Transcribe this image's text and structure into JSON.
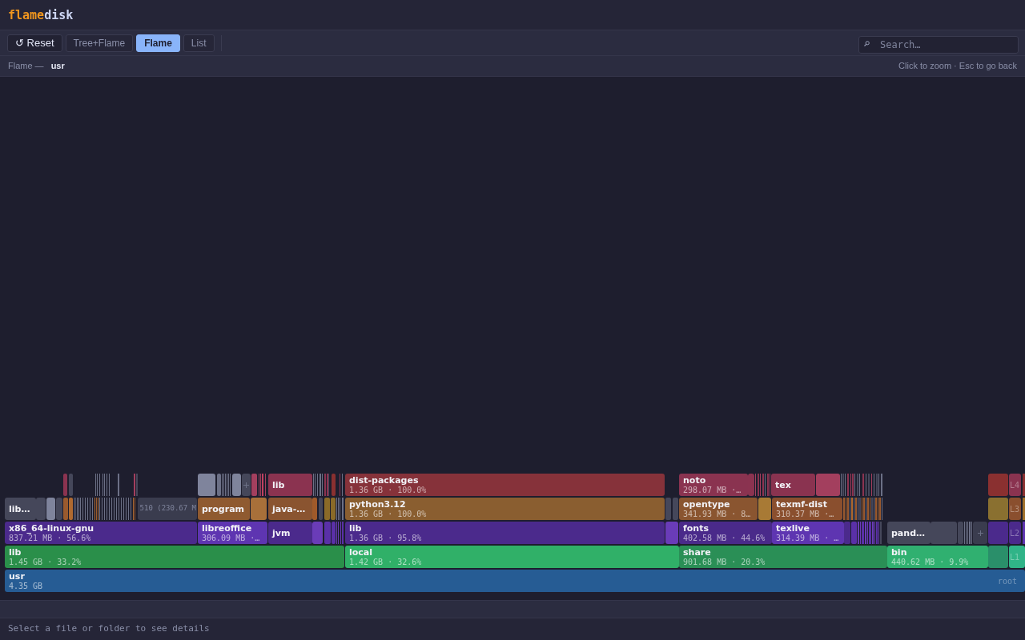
{
  "logo": {
    "accent": "flame",
    "rest": "disk"
  },
  "toolbar": {
    "reset_button": "↺ Reset",
    "view_tabs": [
      {
        "label": "Tree+Flame",
        "selected": false
      },
      {
        "label": "Flame",
        "selected": true
      },
      {
        "label": "List",
        "selected": false
      }
    ],
    "search": {
      "placeholder": "Search…"
    }
  },
  "breadcrumb": {
    "view": "Flame —",
    "current": "usr"
  },
  "hint": "Click to zoom · Esc to go back",
  "flame": {
    "root": {
      "name": "usr",
      "size": "4.35 GB",
      "children": [
        {
          "name": "lib",
          "size": "1.45 GB · 33.2%",
          "children": [
            {
              "name": "x86_64-linux-gnu",
              "size": "837.21 MB · 56.6%",
              "children": [
                {
                  "kind": "folder",
                  "name": "lib…"
                },
                {
                  "kind": "others",
                  "name": "510 (230.67 M"
                }
              ]
            },
            {
              "name": "libreoffice",
              "size": "306.09 MB ·…",
              "children": [
                {
                  "name": "program"
                }
              ]
            },
            {
              "name": "jvm",
              "children": [
                {
                  "name": "java-…",
                  "children": [
                    {
                      "name": "lib"
                    }
                  ]
                }
              ]
            }
          ]
        },
        {
          "name": "local",
          "size": "1.42 GB · 32.6%",
          "children": [
            {
              "name": "lib",
              "size": "1.36 GB · 95.8%",
              "children": [
                {
                  "name": "python3.12",
                  "size": "1.36 GB · 100.0%",
                  "children": [
                    {
                      "name": "dist-packages",
                      "size": "1.36 GB · 100.0%"
                    }
                  ]
                }
              ]
            }
          ]
        },
        {
          "name": "share",
          "size": "901.68 MB · 20.3%",
          "children": [
            {
              "name": "fonts",
              "size": "402.58 MB · 44.6%",
              "children": [
                {
                  "name": "opentype",
                  "size": "341.93 MB · 8…",
                  "children": [
                    {
                      "name": "noto",
                      "size": "298.07 MB ·…"
                    }
                  ]
                }
              ]
            },
            {
              "name": "texlive",
              "size": "314.39 MB · …",
              "children": [
                {
                  "name": "texmf-dist",
                  "size": "310.37 MB ·…",
                  "children": [
                    {
                      "name": "tex"
                    }
                  ]
                }
              ]
            }
          ]
        },
        {
          "name": "bin",
          "size": "440.62 MB · 9.9%",
          "children": [
            {
              "name": "pand…"
            }
          ]
        }
      ]
    },
    "depth_tags": [
      "L4",
      "L3",
      "L2",
      "L1",
      "root"
    ]
  },
  "status_bar": "Select a file or folder to see details"
}
